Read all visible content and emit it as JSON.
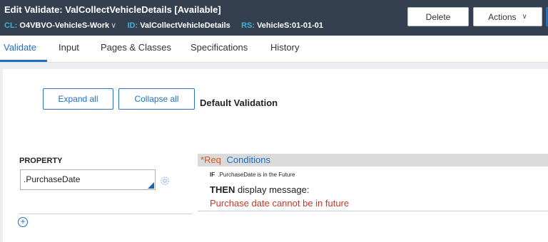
{
  "header": {
    "title": "Edit  Validate: ValCollectVehicleDetails [Available]",
    "cl_label": "CL:",
    "cl_value": "O4VBVO-VehicleS-Work",
    "id_label": "ID:",
    "id_value": "ValCollectVehicleDetails",
    "rs_label": "RS:",
    "rs_value": "VehicleS:01-01-01",
    "delete_label": "Delete",
    "actions_label": "Actions",
    "chevron": "∨"
  },
  "tabs": [
    {
      "label": "Validate",
      "active": true
    },
    {
      "label": "Input"
    },
    {
      "label": "Pages & Classes"
    },
    {
      "label": "Specifications"
    },
    {
      "label": "History"
    }
  ],
  "toolbar": {
    "expand_label": "Expand all",
    "collapse_label": "Collapse all",
    "default_validation": "Default Validation"
  },
  "property": {
    "label": "PROPERTY",
    "value": ".PurchaseDate"
  },
  "conditions": {
    "req": "*Req",
    "link": "Conditions",
    "if_keyword": "IF",
    "if_text": ".PurchaseDate is in the Future",
    "then_keyword": "THEN",
    "then_text": " display message:",
    "message": "Purchase date cannot be in future"
  },
  "icons": {
    "gear": "gear-icon",
    "add": "add-circle-icon"
  },
  "colors": {
    "header_bg": "#34404f",
    "accent": "#1f6fc5",
    "label_cyan": "#3fb4d8",
    "req_orange": "#e0541f",
    "message_red": "#c0392b"
  }
}
